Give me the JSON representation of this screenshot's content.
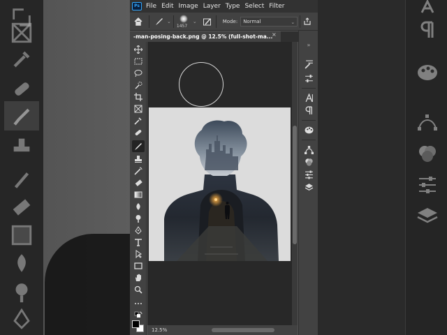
{
  "menu": {
    "app_badge": "Ps",
    "items": [
      "File",
      "Edit",
      "Image",
      "Layer",
      "Type",
      "Select",
      "Filter"
    ]
  },
  "options_bar": {
    "brush_size": "1457",
    "mode_label": "Mode:",
    "mode_value": "Normal"
  },
  "document": {
    "tab_title": "-man-posing-back.png @ 12.5% (full-shot-ma...",
    "close_glyph": "×",
    "zoom": "12.5%"
  },
  "colors": {
    "foreground": "#000000",
    "background": "#ffffff",
    "ps_accent": "#31a8ff"
  },
  "icons": {
    "toolbar": [
      "move-icon",
      "marquee-icon",
      "lasso-icon",
      "quick-select-icon",
      "crop-icon",
      "frame-icon",
      "eyedropper-icon",
      "healing-brush-icon",
      "brush-icon",
      "clone-stamp-icon",
      "history-brush-icon",
      "eraser-icon",
      "gradient-icon",
      "blur-icon",
      "dodge-icon",
      "pen-icon",
      "type-icon",
      "path-select-icon",
      "rectangle-icon",
      "hand-icon",
      "zoom-icon",
      "more-tools-icon"
    ],
    "right_panel": [
      "history-icon",
      "adjust-icon",
      "character-icon",
      "paragraph-icon",
      "color-palette-icon",
      "paths-icon",
      "channels-icon",
      "properties-icon",
      "layers-icon"
    ]
  }
}
